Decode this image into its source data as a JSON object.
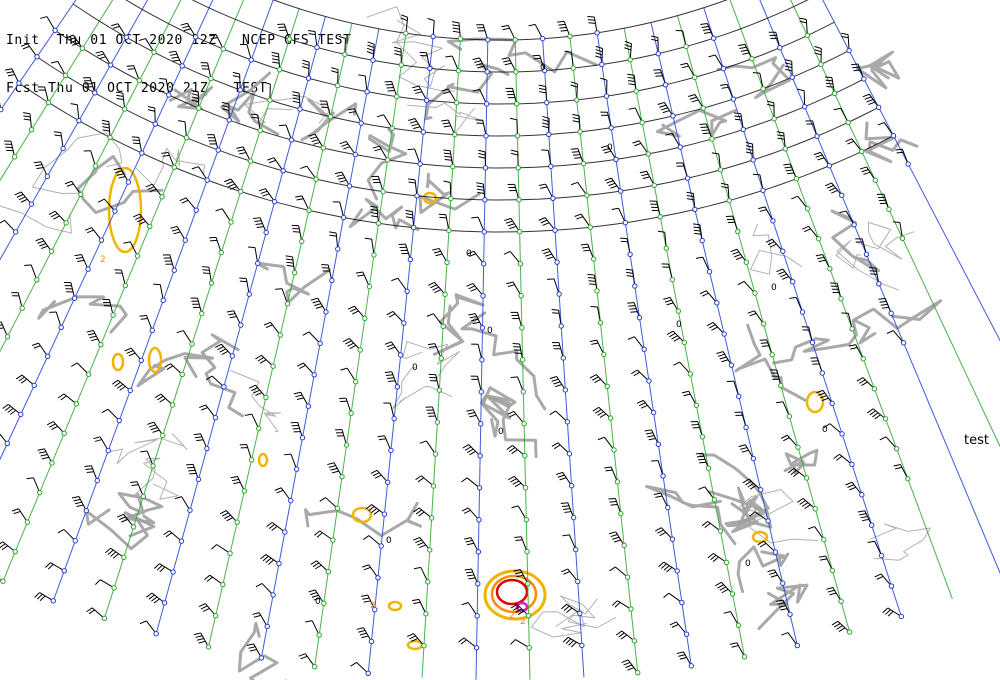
{
  "header": {
    "init_line": "Init  Thu 01 OCT 2020 12Z   NCEP GFS TEST",
    "fcst_line": "Fcst Thu 01 OCT 2020 21Z   TEST"
  },
  "side_label": "test",
  "map": {
    "projection": "polar-stereographic",
    "region": "Europe / North Atlantic",
    "colors": {
      "background": "#ffffff",
      "coastline": "#a8a8a8",
      "gridline_blue": "#1f3fd0",
      "gridline_green": "#2aa52a",
      "wind_barb": "#000000",
      "station_circle": "#1f3fd0",
      "contour_gray": "#a0a0a0",
      "contour_yellow": "#f0b400",
      "contour_orange": "#ff8c00",
      "contour_red": "#e00000",
      "contour_magenta": "#d020d0"
    },
    "contour_labels": [
      "2",
      "2",
      "2",
      "2"
    ],
    "zero_labels": [
      "0",
      "0",
      "0",
      "0",
      "0",
      "0",
      "0",
      "0",
      "0",
      "0",
      "0",
      "0"
    ]
  }
}
